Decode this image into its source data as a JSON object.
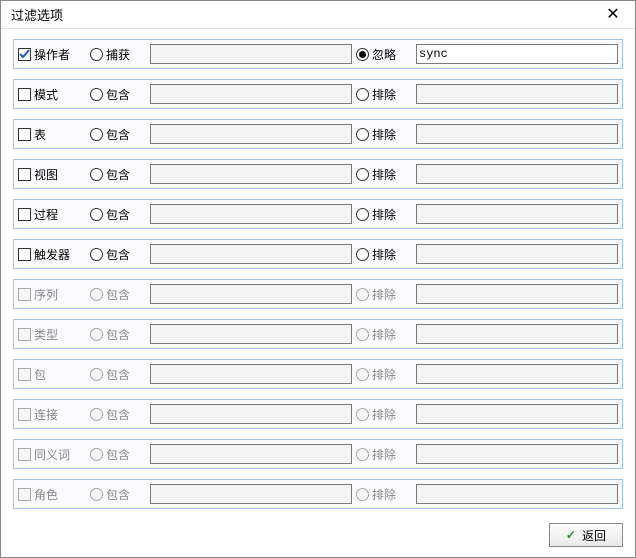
{
  "window": {
    "title": "过滤选项",
    "close_glyph": "✕"
  },
  "labels": {
    "capture": "捕获",
    "ignore": "忽略",
    "include": "包含",
    "exclude": "排除"
  },
  "rows": [
    {
      "id": "operator",
      "name": "操作者",
      "checked": true,
      "enabled": true,
      "left_label_key": "capture",
      "right_label_key": "ignore",
      "selected": "right",
      "left_value": "",
      "right_value": "sync"
    },
    {
      "id": "schema",
      "name": "模式",
      "checked": false,
      "enabled": true,
      "left_label_key": "include",
      "right_label_key": "exclude",
      "selected": "none",
      "left_value": "",
      "right_value": ""
    },
    {
      "id": "table",
      "name": "表",
      "checked": false,
      "enabled": true,
      "left_label_key": "include",
      "right_label_key": "exclude",
      "selected": "none",
      "left_value": "",
      "right_value": ""
    },
    {
      "id": "view",
      "name": "视图",
      "checked": false,
      "enabled": true,
      "left_label_key": "include",
      "right_label_key": "exclude",
      "selected": "none",
      "left_value": "",
      "right_value": ""
    },
    {
      "id": "proc",
      "name": "过程",
      "checked": false,
      "enabled": true,
      "left_label_key": "include",
      "right_label_key": "exclude",
      "selected": "none",
      "left_value": "",
      "right_value": ""
    },
    {
      "id": "trigger",
      "name": "触发器",
      "checked": false,
      "enabled": true,
      "left_label_key": "include",
      "right_label_key": "exclude",
      "selected": "none",
      "left_value": "",
      "right_value": ""
    },
    {
      "id": "sequence",
      "name": "序列",
      "checked": false,
      "enabled": false,
      "left_label_key": "include",
      "right_label_key": "exclude",
      "selected": "none",
      "left_value": "",
      "right_value": ""
    },
    {
      "id": "type",
      "name": "类型",
      "checked": false,
      "enabled": false,
      "left_label_key": "include",
      "right_label_key": "exclude",
      "selected": "none",
      "left_value": "",
      "right_value": ""
    },
    {
      "id": "package",
      "name": "包",
      "checked": false,
      "enabled": false,
      "left_label_key": "include",
      "right_label_key": "exclude",
      "selected": "none",
      "left_value": "",
      "right_value": ""
    },
    {
      "id": "link",
      "name": "连接",
      "checked": false,
      "enabled": false,
      "left_label_key": "include",
      "right_label_key": "exclude",
      "selected": "none",
      "left_value": "",
      "right_value": ""
    },
    {
      "id": "synonym",
      "name": "同义词",
      "checked": false,
      "enabled": false,
      "left_label_key": "include",
      "right_label_key": "exclude",
      "selected": "none",
      "left_value": "",
      "right_value": ""
    },
    {
      "id": "role",
      "name": "角色",
      "checked": false,
      "enabled": false,
      "left_label_key": "include",
      "right_label_key": "exclude",
      "selected": "none",
      "left_value": "",
      "right_value": ""
    }
  ],
  "footer": {
    "back_label": "返回",
    "check_glyph": "✓"
  }
}
